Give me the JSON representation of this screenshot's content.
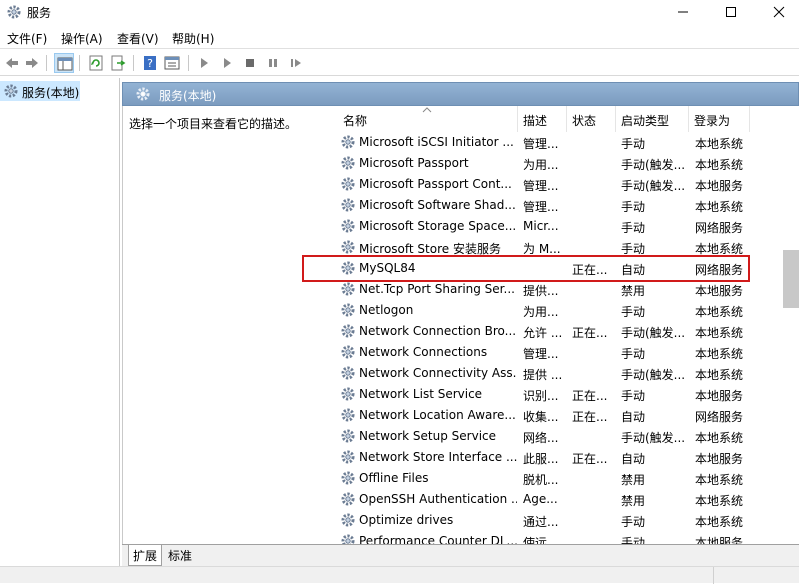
{
  "window": {
    "title": "服务",
    "app_icon": "services-gear-icon"
  },
  "menu": [
    "文件(F)",
    "操作(A)",
    "查看(V)",
    "帮助(H)"
  ],
  "tree": {
    "selected_label": "服务(本地)"
  },
  "panel": {
    "header_label": "服务(本地)",
    "description_prompt": "选择一个项目来查看它的描述。"
  },
  "columns": {
    "name": "名称",
    "description": "描述",
    "status": "状态",
    "startup": "启动类型",
    "logon": "登录为"
  },
  "services": [
    {
      "name": "Microsoft iSCSI Initiator ...",
      "description": "管理...",
      "status": "",
      "startup": "手动",
      "logon": "本地系统"
    },
    {
      "name": "Microsoft Passport",
      "description": "为用...",
      "status": "",
      "startup": "手动(触发...",
      "logon": "本地系统"
    },
    {
      "name": "Microsoft Passport Cont...",
      "description": "管理...",
      "status": "",
      "startup": "手动(触发...",
      "logon": "本地服务"
    },
    {
      "name": "Microsoft Software Shad...",
      "description": "管理...",
      "status": "",
      "startup": "手动",
      "logon": "本地系统"
    },
    {
      "name": "Microsoft Storage Space...",
      "description": "Micr...",
      "status": "",
      "startup": "手动",
      "logon": "网络服务"
    },
    {
      "name": "Microsoft Store 安装服务",
      "description": "为 M...",
      "status": "",
      "startup": "手动",
      "logon": "本地系统"
    },
    {
      "name": "MySQL84",
      "description": "",
      "status": "正在...",
      "startup": "自动",
      "logon": "网络服务"
    },
    {
      "name": "Net.Tcp Port Sharing Ser...",
      "description": "提供...",
      "status": "",
      "startup": "禁用",
      "logon": "本地服务"
    },
    {
      "name": "Netlogon",
      "description": "为用...",
      "status": "",
      "startup": "手动",
      "logon": "本地系统"
    },
    {
      "name": "Network Connection Bro...",
      "description": "允许 ...",
      "status": "正在...",
      "startup": "手动(触发...",
      "logon": "本地系统"
    },
    {
      "name": "Network Connections",
      "description": "管理...",
      "status": "",
      "startup": "手动",
      "logon": "本地系统"
    },
    {
      "name": "Network Connectivity Ass...",
      "description": "提供 ...",
      "status": "",
      "startup": "手动(触发...",
      "logon": "本地系统"
    },
    {
      "name": "Network List Service",
      "description": "识别...",
      "status": "正在...",
      "startup": "手动",
      "logon": "本地服务"
    },
    {
      "name": "Network Location Aware...",
      "description": "收集...",
      "status": "正在...",
      "startup": "自动",
      "logon": "网络服务"
    },
    {
      "name": "Network Setup Service",
      "description": "网络...",
      "status": "",
      "startup": "手动(触发...",
      "logon": "本地系统"
    },
    {
      "name": "Network Store Interface ...",
      "description": "此服...",
      "status": "正在...",
      "startup": "自动",
      "logon": "本地服务"
    },
    {
      "name": "Offline Files",
      "description": "脱机...",
      "status": "",
      "startup": "禁用",
      "logon": "本地系统"
    },
    {
      "name": "OpenSSH Authentication ...",
      "description": "Age...",
      "status": "",
      "startup": "禁用",
      "logon": "本地系统"
    },
    {
      "name": "Optimize drives",
      "description": "通过...",
      "status": "",
      "startup": "手动",
      "logon": "本地系统"
    },
    {
      "name": "Performance Counter DL...",
      "description": "使远...",
      "status": "",
      "startup": "手动",
      "logon": "本地服务"
    }
  ],
  "highlighted_service": "MySQL84",
  "highlight_color": "#d11a1a",
  "tabs": [
    "扩展",
    "标准"
  ]
}
